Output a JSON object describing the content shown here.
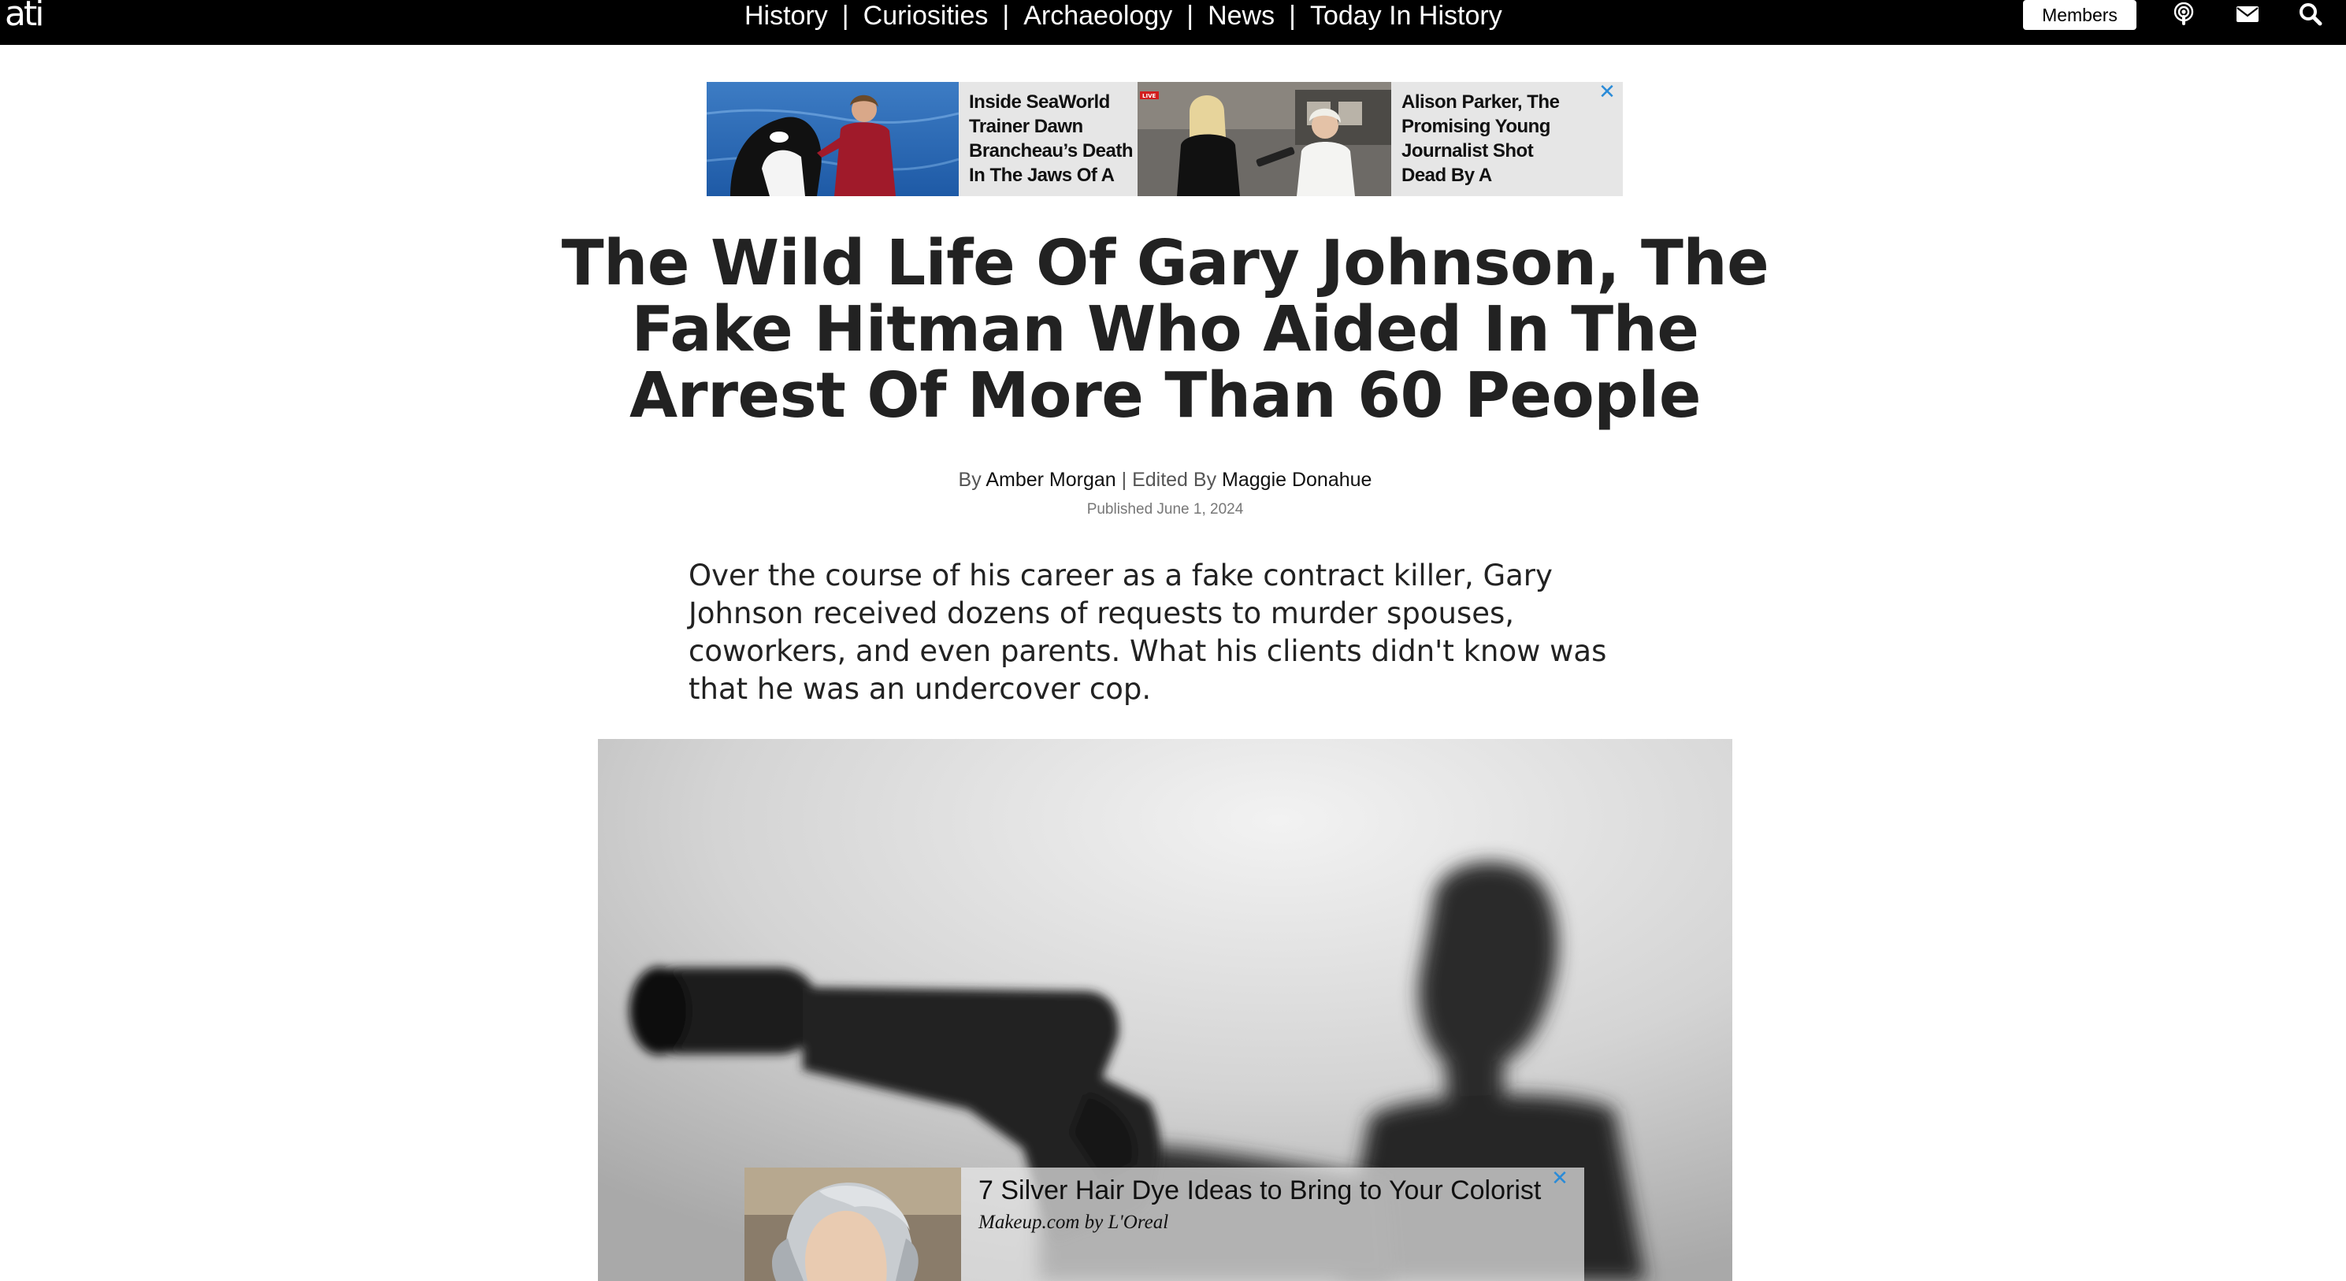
{
  "site": {
    "logo_text": "ati",
    "nav": [
      "History",
      "Curiosities",
      "Archaeology",
      "News",
      "Today In History"
    ],
    "nav_separator": "|",
    "members_label": "Members",
    "icons": [
      "podcast-icon",
      "mail-icon",
      "search-icon"
    ]
  },
  "top_ads": [
    {
      "title": "Inside SeaWorld Trainer Dawn Brancheau’s Death In The Jaws Of A",
      "image": "orca-trainer-photo"
    },
    {
      "title": "Alison Parker, The Promising Young Journalist Shot Dead By A",
      "image": "news-reporter-photo",
      "badge": "LIVE"
    }
  ],
  "ad_close_glyph": "✕",
  "article": {
    "headline": "The Wild Life Of Gary Johnson, The Fake Hitman Who Aided In The Arrest Of More Than 60 People",
    "by_prefix": "By",
    "author": "Amber Morgan",
    "edited_prefix": "| Edited By",
    "editor": "Maggie Donahue",
    "published": "Published June 1, 2024",
    "dek": "Over the course of his career as a fake contract killer, Gary Johnson received dozens of requests to murder spouses, coworkers, and even parents. What his clients didn't know was that he was an undercover cop.",
    "hero_image": "blurred-man-pointing-silenced-pistol"
  },
  "bottom_ad": {
    "title": "7 Silver Hair Dye Ideas to Bring to Your Colorist",
    "source": "Makeup.com by L'Oreal",
    "image": "silver-hair-woman-photo"
  },
  "colors": {
    "topbar": "#000000",
    "text": "#222222",
    "ad_background": "#e6e6e6",
    "ad_close": "#2a8bd8"
  }
}
